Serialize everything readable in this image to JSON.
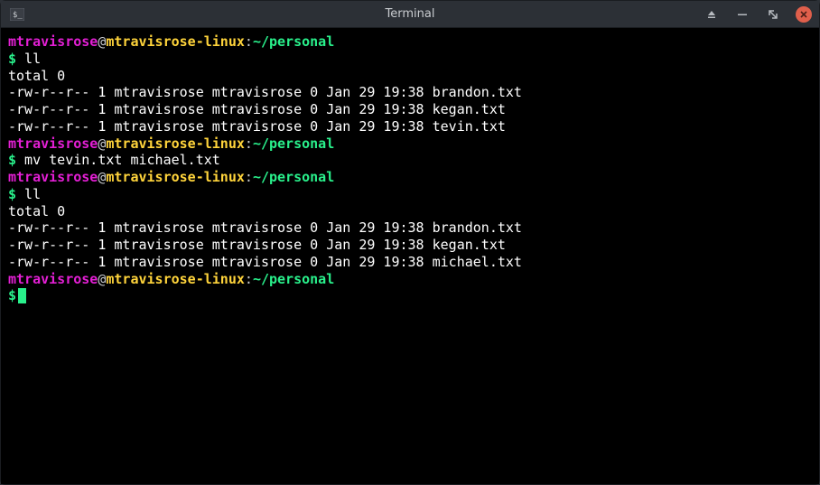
{
  "window": {
    "title": "Terminal",
    "app_icon": "terminal-icon"
  },
  "prompt": {
    "user": "mtravisrose",
    "at": "@",
    "host": "mtravisrose-linux",
    "colon": ":",
    "path": "~/personal",
    "symbol": "$"
  },
  "session": [
    {
      "type": "prompt"
    },
    {
      "type": "cmd",
      "text": "ll"
    },
    {
      "type": "out",
      "text": "total 0"
    },
    {
      "type": "out",
      "text": "-rw-r--r-- 1 mtravisrose mtravisrose 0 Jan 29 19:38 brandon.txt"
    },
    {
      "type": "out",
      "text": "-rw-r--r-- 1 mtravisrose mtravisrose 0 Jan 29 19:38 kegan.txt"
    },
    {
      "type": "out",
      "text": "-rw-r--r-- 1 mtravisrose mtravisrose 0 Jan 29 19:38 tevin.txt"
    },
    {
      "type": "prompt"
    },
    {
      "type": "cmd",
      "text": "mv tevin.txt michael.txt"
    },
    {
      "type": "prompt"
    },
    {
      "type": "cmd",
      "text": "ll"
    },
    {
      "type": "out",
      "text": "total 0"
    },
    {
      "type": "out",
      "text": "-rw-r--r-- 1 mtravisrose mtravisrose 0 Jan 29 19:38 brandon.txt"
    },
    {
      "type": "out",
      "text": "-rw-r--r-- 1 mtravisrose mtravisrose 0 Jan 29 19:38 kegan.txt"
    },
    {
      "type": "out",
      "text": "-rw-r--r-- 1 mtravisrose mtravisrose 0 Jan 29 19:38 michael.txt"
    },
    {
      "type": "prompt"
    },
    {
      "type": "cursor"
    }
  ]
}
